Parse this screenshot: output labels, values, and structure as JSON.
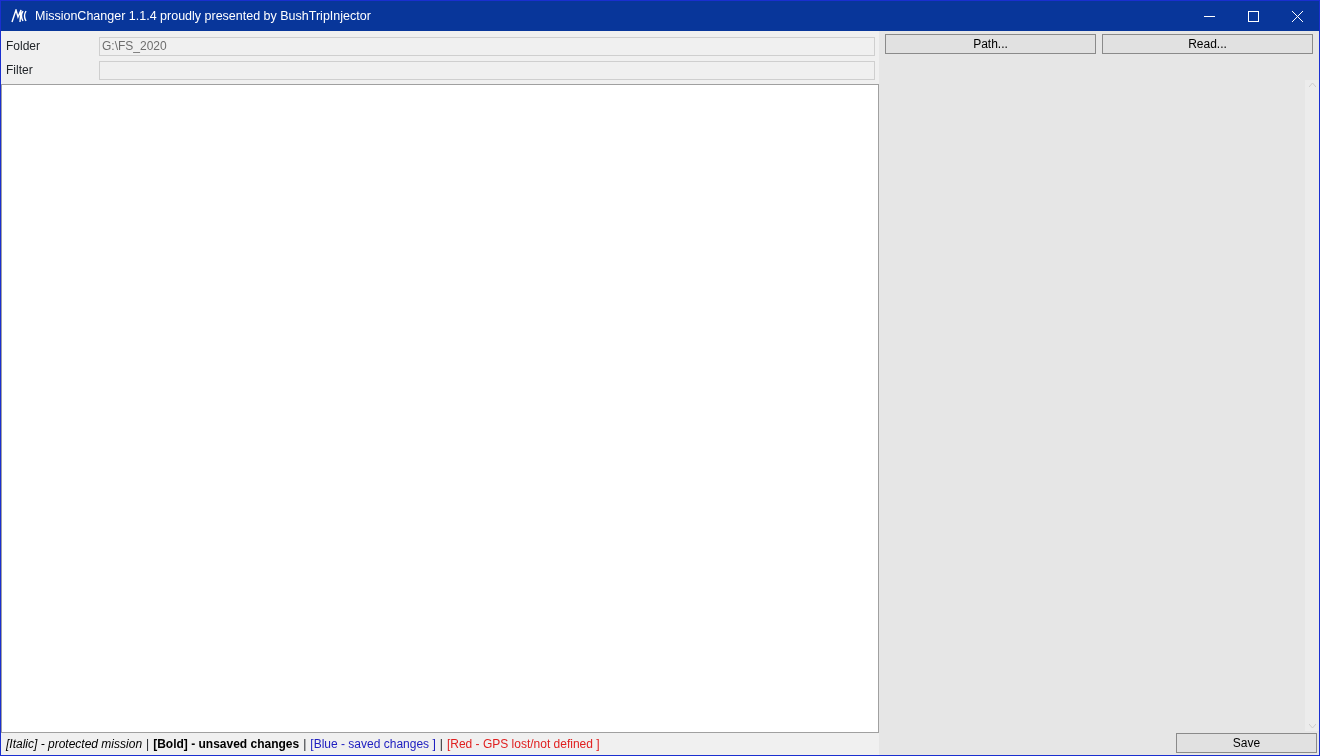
{
  "window": {
    "title": "MissionChanger 1.1.4 proudly presented by BushTripInjector"
  },
  "fields": [
    {
      "label": "Folder",
      "value": "G:\\FS_2020"
    },
    {
      "label": "Filter"
    }
  ],
  "buttons": [
    "Path...",
    "Read..."
  ],
  "legend": [
    {
      "kind": "italic",
      "text": "[Italic] - protected mission",
      "color": "#000000"
    },
    {
      "kind": "separator",
      "text": "|"
    },
    {
      "kind": "bold",
      "text": "[Bold] - unsaved changes",
      "color": "#000000"
    },
    {
      "kind": "separator",
      "text": "|"
    },
    {
      "kind": "plain",
      "text": "[Blue - saved changes ]",
      "color": "#2020c0"
    },
    {
      "kind": "separator",
      "text": "|"
    },
    {
      "kind": "plain",
      "text": "[Red - GPS lost/not defined ]",
      "color": "#e02020"
    }
  ],
  "save_button": "Save"
}
